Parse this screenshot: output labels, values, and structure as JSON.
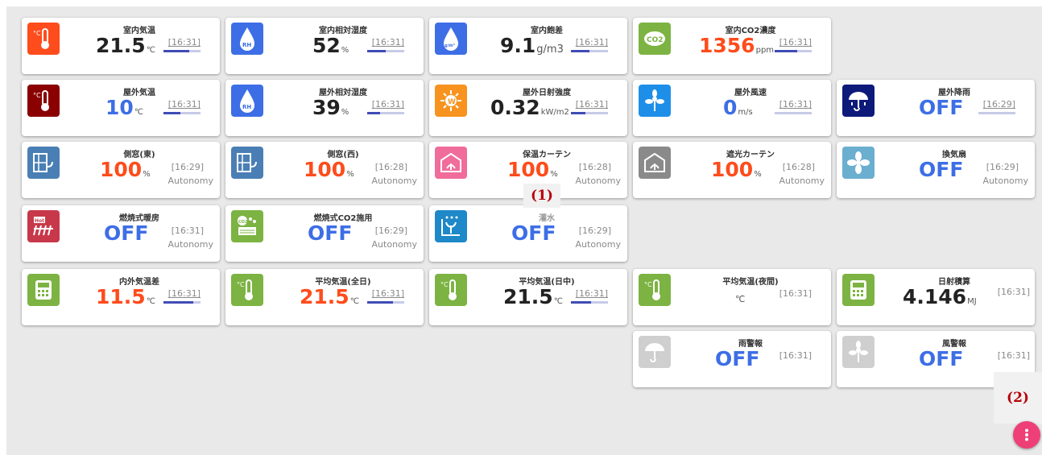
{
  "colors": {
    "orange": "#fe4c1c",
    "blue": "#3d6ee6",
    "fab": "#ee3f77",
    "bar": "#3f4cb6"
  },
  "cards": {
    "indoor_temp": {
      "title": "室内気温",
      "value": "21.5",
      "unit": "℃",
      "time": "[16:31]",
      "progress": 0.7
    },
    "indoor_humidity": {
      "title": "室内相対湿度",
      "value": "52",
      "unit": "%",
      "time": "[16:31]",
      "progress": 0.5
    },
    "indoor_deficit": {
      "title": "室内飽差",
      "value": "9.1",
      "unit": "g/m3",
      "time": "[16:31]",
      "progress": 0.5
    },
    "indoor_co2": {
      "title": "室内CO2濃度",
      "value": "1356",
      "unit": "ppm",
      "time": "[16:31]",
      "progress": 0.6
    },
    "outdoor_temp": {
      "title": "屋外気温",
      "value": "10",
      "unit": "℃",
      "time": "[16:31]",
      "progress": 0.45
    },
    "outdoor_humidity": {
      "title": "屋外相対湿度",
      "value": "39",
      "unit": "%",
      "time": "[16:31]",
      "progress": 0.35
    },
    "outdoor_solar": {
      "title": "屋外日射強度",
      "value": "0.32",
      "unit": "kW/m2",
      "time": "[16:31]",
      "progress": 0.4
    },
    "outdoor_wind": {
      "title": "屋外風速",
      "value": "0",
      "unit": "m/s",
      "time": "[16:31]",
      "progress": 0.0
    },
    "outdoor_rain": {
      "title": "屋外降雨",
      "value": "OFF",
      "time": "[16:29]",
      "progress": 0.0
    },
    "side_window_east": {
      "title": "側窓(東)",
      "value": "100",
      "unit": "%",
      "time": "[16:29]",
      "mode": "Autonomy"
    },
    "side_window_west": {
      "title": "側窓(西)",
      "value": "100",
      "unit": "%",
      "time": "[16:28]",
      "mode": "Autonomy"
    },
    "thermal_curtain": {
      "title": "保温カーテン",
      "value": "100",
      "unit": "%",
      "time": "[16:28]",
      "mode": "Autonomy"
    },
    "shade_curtain": {
      "title": "遮光カーテン",
      "value": "100",
      "unit": "%",
      "time": "[16:28]",
      "mode": "Autonomy"
    },
    "ventilation_fan": {
      "title": "換気扇",
      "value": "OFF",
      "time": "[16:29]",
      "mode": "Autonomy"
    },
    "combustion_heater": {
      "title": "燃焼式暖房",
      "value": "OFF",
      "time": "[16:31]",
      "mode": "Autonomy"
    },
    "combustion_co2": {
      "title": "燃焼式CO2施用",
      "value": "OFF",
      "time": "[16:29]",
      "mode": "Autonomy"
    },
    "irrigation": {
      "title": "灌水",
      "value": "OFF",
      "time": "[16:29]",
      "mode": "Autonomy"
    },
    "temp_diff": {
      "title": "内外気温差",
      "value": "11.5",
      "unit": "℃",
      "time": "[16:31]",
      "progress": 0.8
    },
    "avg_temp_all": {
      "title": "平均気温(全日)",
      "value": "21.5",
      "unit": "℃",
      "time": "[16:31]",
      "progress": 0.7
    },
    "avg_temp_day": {
      "title": "平均気温(日中)",
      "value": "21.5",
      "unit": "℃",
      "time": "[16:31]",
      "progress": 0.55
    },
    "avg_temp_night": {
      "title": "平均気温(夜間)",
      "value": "",
      "unit": "℃",
      "time": "[16:31]"
    },
    "solar_total": {
      "title": "日射積算",
      "value": "4.146",
      "unit": "MJ",
      "time": "[16:31]"
    },
    "rain_alarm": {
      "title": "雨警報",
      "value": "OFF",
      "time": "[16:31]"
    },
    "wind_alarm": {
      "title": "風警報",
      "value": "OFF",
      "time": "[16:31]"
    }
  },
  "icons": {
    "rh": "RH",
    "co2": "CO2",
    "w": "W",
    "hot": "Hot",
    "co2s": "CO2",
    "dew": "g/m³"
  },
  "annotations": {
    "a1": "(1)",
    "a2": "(2)"
  }
}
